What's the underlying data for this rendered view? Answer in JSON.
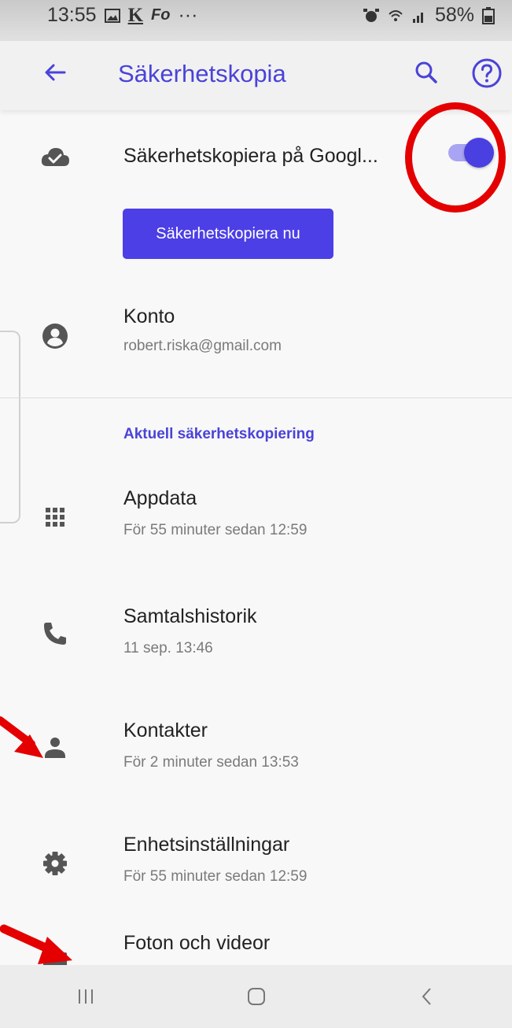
{
  "status_bar": {
    "time": "13:55",
    "app_icons": [
      "K",
      "Fo",
      "···"
    ],
    "battery": "58%"
  },
  "app_bar": {
    "title": "Säkerhetskopia",
    "back_icon": "arrow-left-icon",
    "search_icon": "search-icon",
    "help_icon": "help-icon"
  },
  "backup_toggle": {
    "label": "Säkerhetskopiera på Googl...",
    "enabled": true,
    "icon": "cloud-check-icon"
  },
  "backup_now_button": {
    "label": "Säkerhetskopiera nu"
  },
  "account": {
    "title": "Konto",
    "email": "robert.riska@gmail.com",
    "icon": "account-circle-icon"
  },
  "section": {
    "header": "Aktuell säkerhetskopiering"
  },
  "items": [
    {
      "title": "Appdata",
      "subtitle": "För 55 minuter sedan 12:59",
      "icon": "apps-grid-icon"
    },
    {
      "title": "Samtalshistorik",
      "subtitle": "11 sep. 13:46",
      "icon": "phone-icon"
    },
    {
      "title": "Kontakter",
      "subtitle": "För 2 minuter sedan 13:53",
      "icon": "person-icon"
    },
    {
      "title": "Enhetsinställningar",
      "subtitle": "För 55 minuter sedan 12:59",
      "icon": "gear-icon"
    },
    {
      "title": "Foton och videor",
      "subtitle": "",
      "icon": "photo-icon"
    }
  ],
  "nav_bar": [
    "recents-icon",
    "home-icon",
    "back-icon"
  ],
  "colors": {
    "accent": "#4a43d8",
    "button": "#4c3fe6",
    "annotation": "#e40000"
  }
}
